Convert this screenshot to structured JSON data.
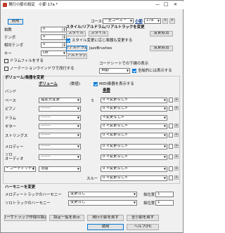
{
  "window": {
    "title": "現行小節の設定　小節 17a *",
    "controls": {
      "minimize": "—",
      "maximize": "□",
      "close": "✕"
    }
  },
  "top": {
    "apply": "適用",
    "course_label": "コース:",
    "course_value": "* 全コース *",
    "measure_label": "小節",
    "measure_value": "17a",
    "prev": "<",
    "next": ">"
  },
  "left_fields": [
    {
      "label": "拍数",
      "value": "0"
    },
    {
      "label": "テンポ",
      "value": "0"
    },
    {
      "label": "相対テンポ",
      "value": "0"
    },
    {
      "label": "キー",
      "value": "Db"
    }
  ],
  "checks": {
    "drum_fill": "ドラムフィルをする",
    "notation_window": "ノーテーションウインドウで改行する"
  },
  "style": {
    "heading": "スタイル/リアルドラム/リアルトラックを変更",
    "style_btn1": "スタイル",
    "style_btn2": "スタイル",
    "change_cancel": "変更取消",
    "reset_check": "スタイル変更に応じ楽器も変更する",
    "realdrums_btn": "リアルドラム",
    "realdrums_value": "JazzBrushes",
    "change_cancel2": "変更取消",
    "realtracks_btn": "リアルトラック"
  },
  "chord": {
    "label": "コードシートでの下線の表示",
    "value": "自動",
    "all_check": "全絵的には表示する"
  },
  "instruments": {
    "heading": "ボリューム/楽器を変更",
    "col_volume": "ボリューム",
    "col_change": "(数値)",
    "midi_check": "MIDI楽器を表示する",
    "col_instrument": "楽器",
    "rows": [
      {
        "name": "バンド",
        "volume": "",
        "num": "",
        "instrument": ""
      },
      {
        "name": "ベース",
        "volume": "指定分変更",
        "num": "5",
        "instrument": "0 <変更なし>"
      },
      {
        "name": "ピアノ",
        "volume": "-------",
        "num": "",
        "instrument": "0 <変更なし>"
      },
      {
        "name": "ドラム",
        "volume": "-------",
        "num": "",
        "instrument": "<変更なし>"
      },
      {
        "name": "ギター",
        "volume": "-------",
        "num": "",
        "instrument": "0 <変更なし>"
      },
      {
        "name": "ストリングス",
        "volume": "-------",
        "num": "",
        "instrument": "0 <変更なし>"
      },
      {
        "name": "メロディー",
        "volume": "-------",
        "num": "",
        "instrument": "0 <変更なし>"
      },
      {
        "name": "ソロ\nオーディオ",
        "volume": "-------",
        "num": "",
        "instrument": "0 <変更なし>"
      },
      {
        "name": "* ユーティリティ",
        "volume": "消音",
        "num": "",
        "instrument": "0 <変更なし>"
      },
      {
        "name": "",
        "volume": "",
        "num": "",
        "instrument": "0 <変更なし>"
      }
    ],
    "slur_label": "スルー"
  },
  "harmony": {
    "heading": "ハーモニーを変更",
    "melody_label": "メロディートラックのハーモニー",
    "melody_value": "変更なし",
    "melody_beat_label": "拍位置",
    "melody_beat": "1",
    "solo_label": "ソロトラックのハーモニー",
    "solo_value": "変更なし",
    "solo_beat_label": "拍位置",
    "solo_beat": "1"
  },
  "bottom": {
    "user_track": "ユーザトラック作成の設定",
    "setting_display": "設定一覧を表示",
    "current_revert": "現行小節を戻す",
    "all_revert": "全小節を戻す",
    "apply": "適用",
    "help": "ヘルプ(H)"
  },
  "colors": {
    "accent": "#0078d7",
    "bg": "#f0f0f0"
  }
}
